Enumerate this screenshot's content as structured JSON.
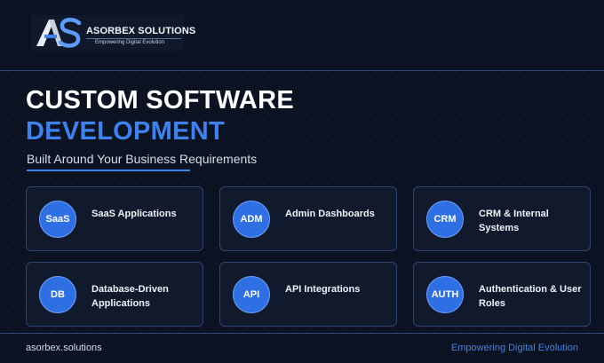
{
  "brand": {
    "name": "ASORBEX SOLUTIONS",
    "tagline": "Empowering Digital Evolution"
  },
  "hero": {
    "title_line1": "CUSTOM SOFTWARE",
    "title_line2": "DEVELOPMENT",
    "subtitle": "Built Around Your Business Requirements"
  },
  "services": [
    {
      "badge": "SaaS",
      "label": "SaaS Applications"
    },
    {
      "badge": "ADM",
      "label": "Admin Dashboards"
    },
    {
      "badge": "CRM",
      "label": "CRM & Internal Systems"
    },
    {
      "badge": "DB",
      "label": "Database-Driven Applications"
    },
    {
      "badge": "API",
      "label": "API Integrations"
    },
    {
      "badge": "AUTH",
      "label": "Authentication & User Roles"
    }
  ],
  "footer": {
    "website": "asorbex.solutions",
    "tagline": "Empowering Digital Evolution"
  },
  "colors": {
    "background": "#0b1322",
    "accent": "#3d82ee",
    "card": "#111a2d",
    "card_border": "#2d466f"
  }
}
